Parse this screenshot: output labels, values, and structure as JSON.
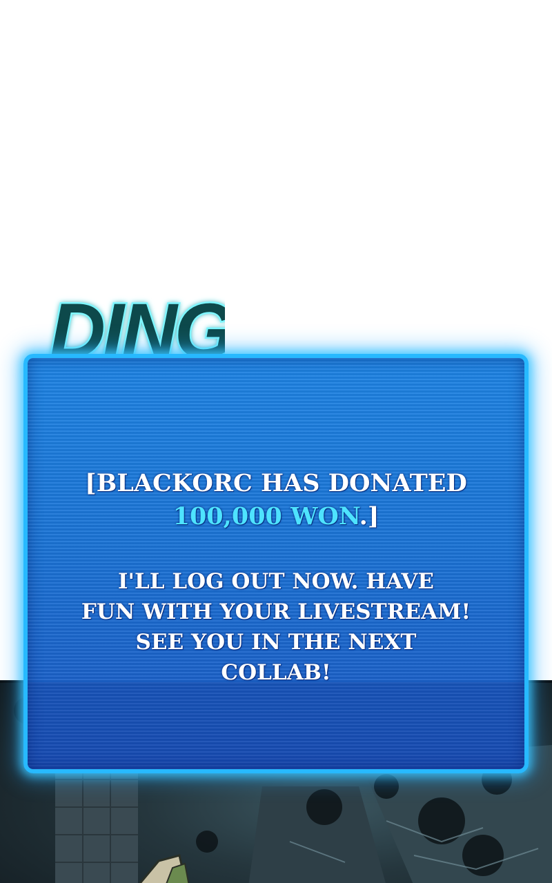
{
  "sfx": {
    "text": "DING",
    "color": "#0f4a4c",
    "glow": "#7ff7ff"
  },
  "donation": {
    "line1": "[BLACKORC HAS DONATED",
    "amount": "100,000 WON",
    "line2_suffix": ".]",
    "message_lines": [
      "I'LL LOG OUT NOW. HAVE",
      "FUN WITH YOUR LIVESTREAM!",
      "SEE YOU IN THE NEXT",
      "COLLAB!"
    ],
    "accent_color": "#4ee3ff",
    "border_color": "#27b9ff",
    "panel_color": "#1e84e4"
  }
}
